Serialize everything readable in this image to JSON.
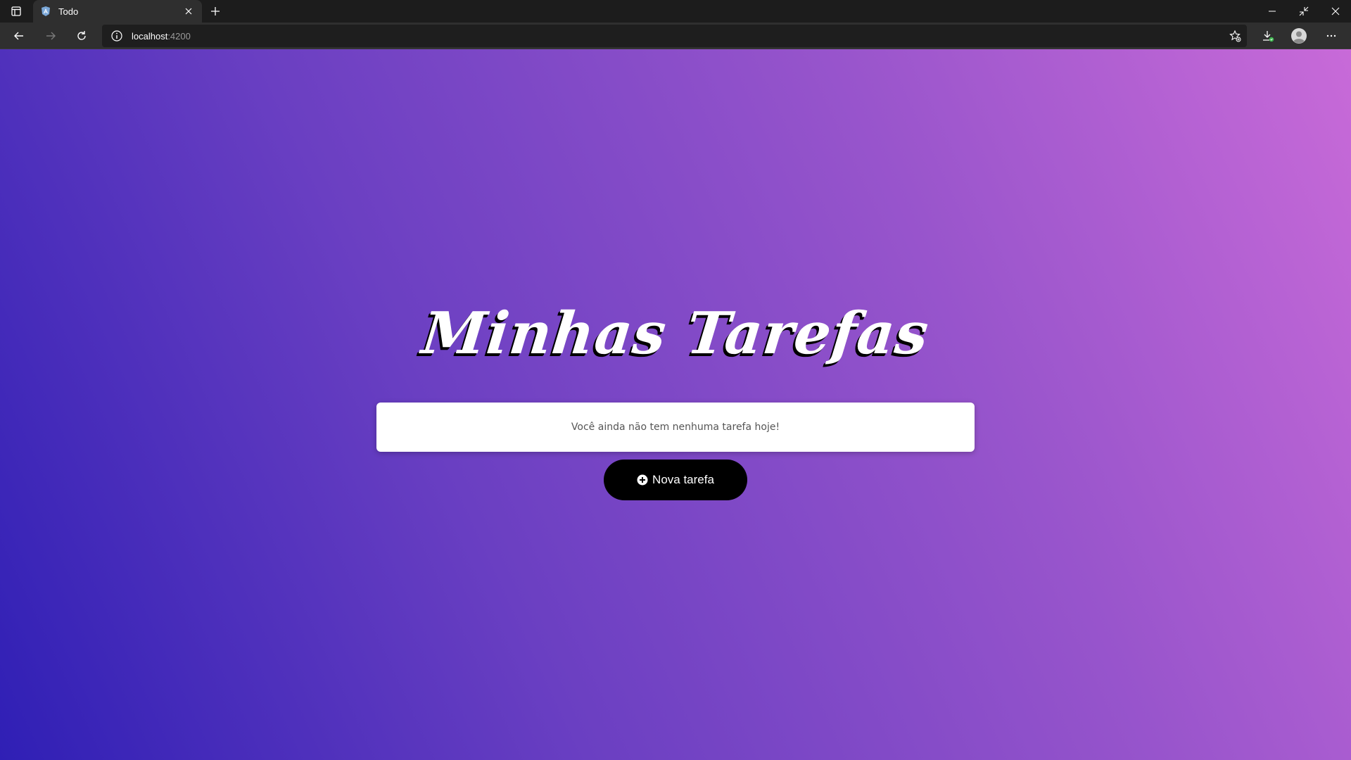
{
  "browser": {
    "tab": {
      "title": "Todo"
    },
    "address": {
      "host": "localhost",
      "port": ":4200"
    }
  },
  "page": {
    "title": "Minhas Tarefas",
    "empty_message": "Você ainda não tem nenhuma tarefa hoje!",
    "new_task_label": "Nova tarefa"
  },
  "colors": {
    "gradient_start": "#2f1fb5",
    "gradient_end": "#c86ad8",
    "button_bg": "#000000",
    "card_bg": "#ffffff"
  },
  "icons": {
    "sidebar_toggle": "sidebar-toggle-icon",
    "favicon": "angular-favicon-icon",
    "tab_close": "close-icon",
    "new_tab": "plus-icon",
    "back": "back-arrow-icon",
    "forward": "forward-arrow-icon",
    "reload": "reload-icon",
    "info": "info-icon",
    "favorites": "star-add-icon",
    "downloads": "download-icon",
    "profile": "avatar-icon",
    "menu": "more-icon",
    "minimize": "minimize-icon",
    "restore": "restore-icon",
    "close_window": "close-icon",
    "new_task": "plus-circle-icon"
  }
}
